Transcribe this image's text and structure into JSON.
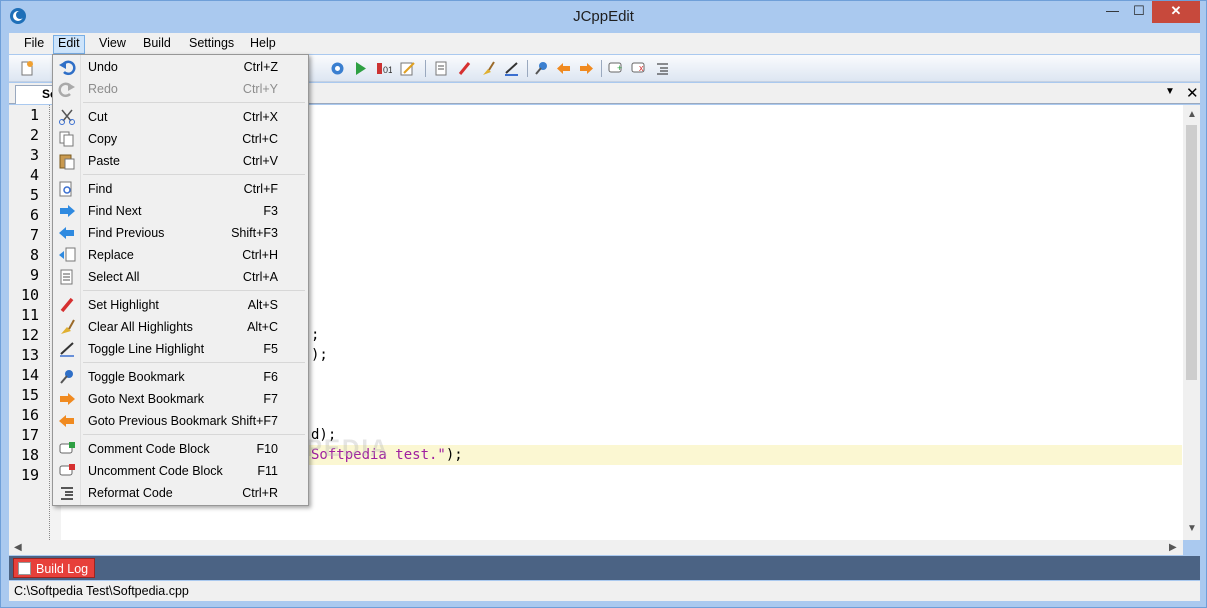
{
  "window": {
    "title": "JCppEdit",
    "min": "—",
    "max": "☐",
    "close": "✕"
  },
  "menubar": [
    "File",
    "Edit",
    "View",
    "Build",
    "Settings",
    "Help"
  ],
  "tab": {
    "label": "Soft"
  },
  "line_numbers": [
    "1",
    "2",
    "3",
    "4",
    "5",
    "6",
    "7",
    "8",
    "9",
    "10",
    "11",
    "12",
    "13",
    "14",
    "15",
    "16",
    "17",
    "18",
    "19"
  ],
  "code_fragments": [
    {
      "text": ";",
      "row": 12
    },
    {
      "text": ");",
      "row": 13
    },
    {
      "text": "d);",
      "row": 17
    },
    {
      "text": "Softpedia test.\");",
      "row": 18
    }
  ],
  "watermark": "SOFTPEDIA",
  "edit_menu": {
    "items": [
      {
        "label": "Undo",
        "shortcut": "Ctrl+Z",
        "icon": "undo-icon",
        "enabled": true
      },
      {
        "label": "Redo",
        "shortcut": "Ctrl+Y",
        "icon": "redo-icon",
        "enabled": false
      },
      {
        "label": "Cut",
        "shortcut": "Ctrl+X",
        "icon": "cut-icon",
        "enabled": true
      },
      {
        "label": "Copy",
        "shortcut": "Ctrl+C",
        "icon": "copy-icon",
        "enabled": true
      },
      {
        "label": "Paste",
        "shortcut": "Ctrl+V",
        "icon": "paste-icon",
        "enabled": true
      },
      {
        "label": "Find",
        "shortcut": "Ctrl+F",
        "icon": "find-icon",
        "enabled": true
      },
      {
        "label": "Find Next",
        "shortcut": "F3",
        "icon": "arrow-right-icon",
        "enabled": true
      },
      {
        "label": "Find Previous",
        "shortcut": "Shift+F3",
        "icon": "arrow-left-icon",
        "enabled": true
      },
      {
        "label": "Replace",
        "shortcut": "Ctrl+H",
        "icon": "replace-icon",
        "enabled": true
      },
      {
        "label": "Select All",
        "shortcut": "Ctrl+A",
        "icon": "select-all-icon",
        "enabled": true
      },
      {
        "label": "Set Highlight",
        "shortcut": "Alt+S",
        "icon": "highlighter-icon",
        "enabled": true
      },
      {
        "label": "Clear All Highlights",
        "shortcut": "Alt+C",
        "icon": "broom-icon",
        "enabled": true
      },
      {
        "label": "Toggle Line Highlight",
        "shortcut": "F5",
        "icon": "pen-icon",
        "enabled": true
      },
      {
        "label": "Toggle Bookmark",
        "shortcut": "F6",
        "icon": "pushpin-icon",
        "enabled": true
      },
      {
        "label": "Goto Next Bookmark",
        "shortcut": "F7",
        "icon": "orange-arrow-right-icon",
        "enabled": true
      },
      {
        "label": "Goto Previous Bookmark",
        "shortcut": "Shift+F7",
        "icon": "orange-arrow-left-icon",
        "enabled": true
      },
      {
        "label": "Comment Code Block",
        "shortcut": "F10",
        "icon": "comment-icon",
        "enabled": true
      },
      {
        "label": "Uncomment Code Block",
        "shortcut": "F11",
        "icon": "uncomment-icon",
        "enabled": true
      },
      {
        "label": "Reformat Code",
        "shortcut": "Ctrl+R",
        "icon": "reformat-icon",
        "enabled": true
      }
    ]
  },
  "bottom": {
    "build_log": "Build Log"
  },
  "status": {
    "path": "C:\\Softpedia Test\\Softpedia.cpp"
  },
  "colors": {
    "accent": "#aac9ef",
    "close": "#c7493c",
    "build_log": "#e7403a",
    "highlight_line": "#fbf7d2",
    "string": "#a020a0"
  }
}
